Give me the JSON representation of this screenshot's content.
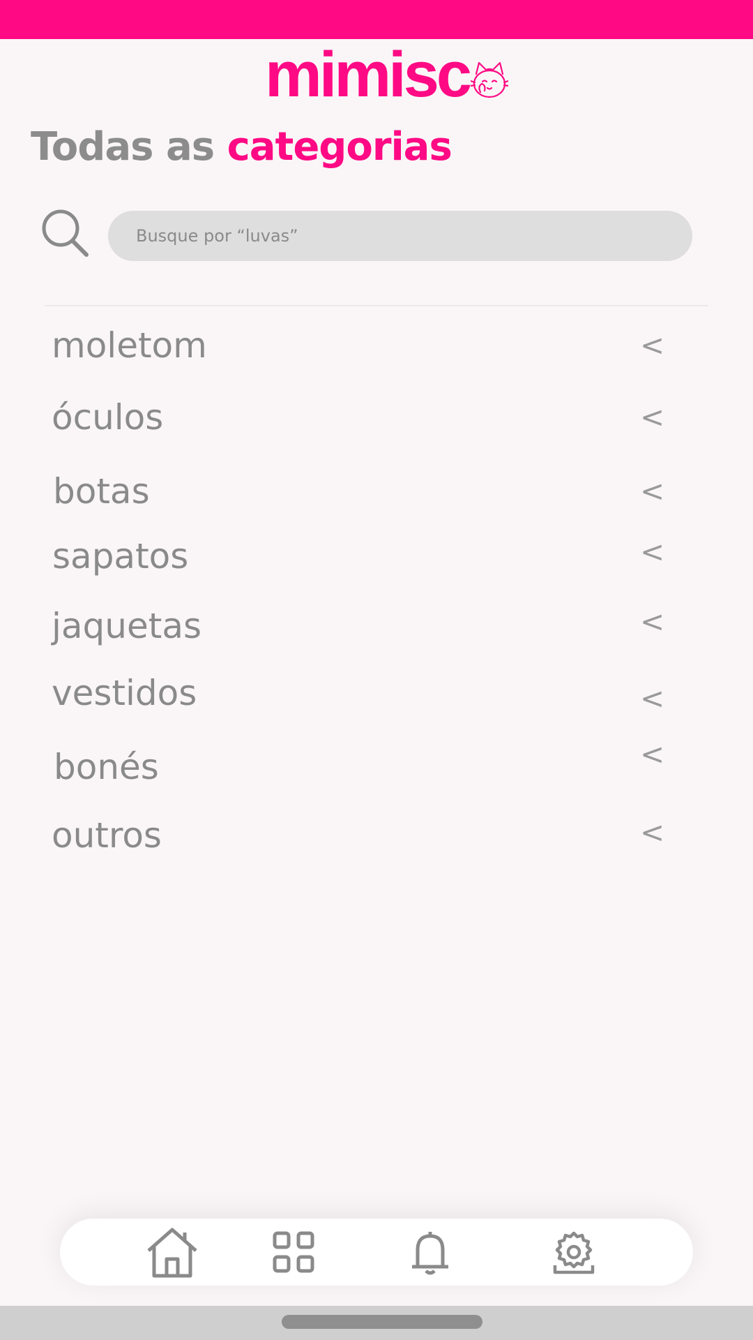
{
  "app": {
    "brand": "mimisc",
    "colors": {
      "accent": "#ff0a84",
      "text": "#8a8a8a",
      "background": "#faf6f8"
    }
  },
  "title": {
    "prefix": "Todas as",
    "accent": "categorias"
  },
  "search": {
    "placeholder": "Busque por “luvas”",
    "value": ""
  },
  "categories": [
    {
      "label": "moletom",
      "chevron": "<"
    },
    {
      "label": "óculos",
      "chevron": "<"
    },
    {
      "label": "botas",
      "chevron": "<"
    },
    {
      "label": "sapatos",
      "chevron": "<"
    },
    {
      "label": "jaquetas",
      "chevron": "<"
    },
    {
      "label": "vestidos",
      "chevron": "<"
    },
    {
      "label": "bonés",
      "chevron": "<"
    },
    {
      "label": "outros",
      "chevron": "<"
    }
  ],
  "nav": [
    {
      "icon": "home-icon"
    },
    {
      "icon": "grid-icon"
    },
    {
      "icon": "bell-icon"
    },
    {
      "icon": "gear-upload-icon"
    }
  ]
}
